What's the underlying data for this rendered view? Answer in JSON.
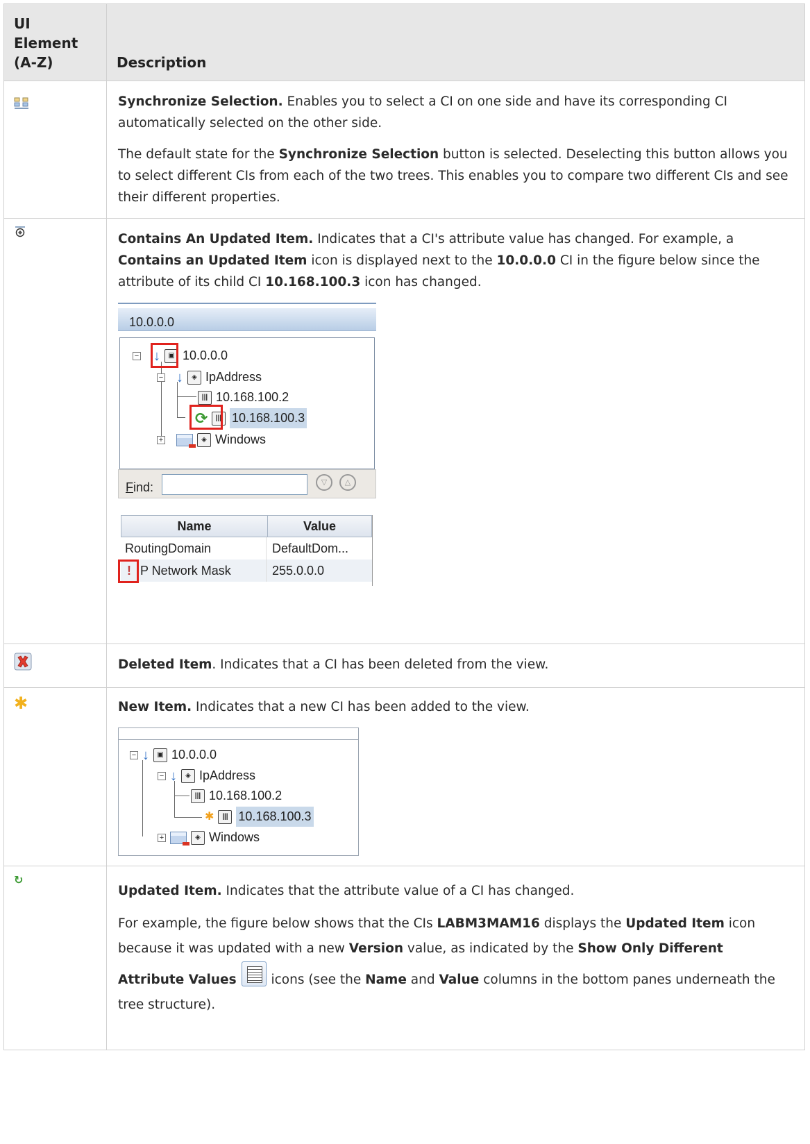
{
  "header": {
    "col1": "UI Element (A-Z)",
    "col2": "Description"
  },
  "rows": {
    "sync": {
      "icon": "synchronize-selection-icon",
      "title": "Synchronize Selection.",
      "text1": " Enables you to select a CI on one side and have its corresponding CI automatically selected on the other side.",
      "p2a": "The default state for the ",
      "p2b": "Synchronize Selection",
      "p2c": " button is selected. Deselecting this button allows you to select different CIs from each of the two trees. This enables you to compare two different CIs and see their different properties."
    },
    "contains": {
      "icon": "contains-updated-item-icon",
      "title": "Contains An Updated Item.",
      "t1": " Indicates that a CI's attribute value has changed. For example, a ",
      "t2": "Contains an Updated Item",
      "t3": " icon is displayed next to the ",
      "t4": "10.0.0.0",
      "t5": " CI in the figure below since the attribute of its child CI ",
      "t6": "10.168.100.3",
      "t7": " icon has changed.",
      "shot": {
        "title": "10.0.0.0",
        "nodes": [
          "10.0.0.0",
          "IpAddress",
          "10.168.100.2",
          "10.168.100.3",
          "Windows"
        ],
        "find_label": "Find:",
        "find_underline": "F",
        "find_rest": "ind:",
        "table_headers": [
          "Name",
          "Value"
        ],
        "table_rows": [
          [
            "RoutingDomain",
            "DefaultDom..."
          ],
          [
            "P Network Mask",
            "255.0.0.0"
          ]
        ],
        "warn_glyph": "!"
      }
    },
    "deleted": {
      "icon": "deleted-item-icon",
      "title": "Deleted Item",
      "text": ". Indicates that a CI has been deleted from the view."
    },
    "new": {
      "icon": "new-item-icon",
      "title": "New Item.",
      "text": " Indicates that a new CI has been added to the view.",
      "shot": {
        "nodes": [
          "10.0.0.0",
          "IpAddress",
          "10.168.100.2",
          "10.168.100.3",
          "Windows"
        ]
      }
    },
    "updated": {
      "icon": "updated-item-icon",
      "title": "Updated Item.",
      "text": " Indicates that the attribute value of a CI has changed.",
      "p2": [
        "For example, the figure below shows that the CIs ",
        "LABM3MAM16",
        " displays the ",
        "Updated Item",
        " icon because it was updated with a new ",
        "Version",
        " value, as indicated by the ",
        "Show Only Different Attribute Values",
        " ",
        "icons (see the ",
        "Name",
        " and ",
        "Value",
        " columns in the bottom panes underneath the tree structure)."
      ]
    }
  }
}
